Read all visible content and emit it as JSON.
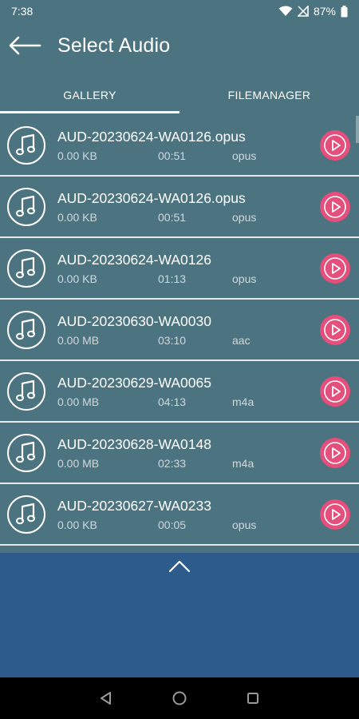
{
  "status_bar": {
    "time": "7:38",
    "battery": "87%"
  },
  "app_bar": {
    "title": "Select Audio"
  },
  "tabs": [
    {
      "label": "GALLERY",
      "active": true
    },
    {
      "label": "FILEMANAGER",
      "active": false
    }
  ],
  "files": [
    {
      "name": "AUD-20230624-WA0126.opus",
      "size": "0.00 KB",
      "duration": "00:51",
      "format": "opus"
    },
    {
      "name": "AUD-20230624-WA0126.opus",
      "size": "0.00 KB",
      "duration": "00:51",
      "format": "opus"
    },
    {
      "name": "AUD-20230624-WA0126",
      "size": "0.00 KB",
      "duration": "01:13",
      "format": "opus"
    },
    {
      "name": "AUD-20230630-WA0030",
      "size": "0.00 MB",
      "duration": "03:10",
      "format": "aac"
    },
    {
      "name": "AUD-20230629-WA0065",
      "size": "0.00 MB",
      "duration": "04:13",
      "format": "m4a"
    },
    {
      "name": "AUD-20230628-WA0148",
      "size": "0.00 MB",
      "duration": "02:33",
      "format": "m4a"
    },
    {
      "name": "AUD-20230627-WA0233",
      "size": "0.00 KB",
      "duration": "00:05",
      "format": "opus"
    }
  ],
  "icons": {
    "back": "arrow-left-icon",
    "file": "music-note-icon",
    "play": "play-icon",
    "expand": "chevron-up-icon",
    "nav": [
      "back-triangle-icon",
      "home-circle-icon",
      "recents-square-icon"
    ]
  },
  "colors": {
    "background": "#4c7380",
    "accent_play": "#e44f7b",
    "bottom_panel": "#2c5b8c"
  }
}
